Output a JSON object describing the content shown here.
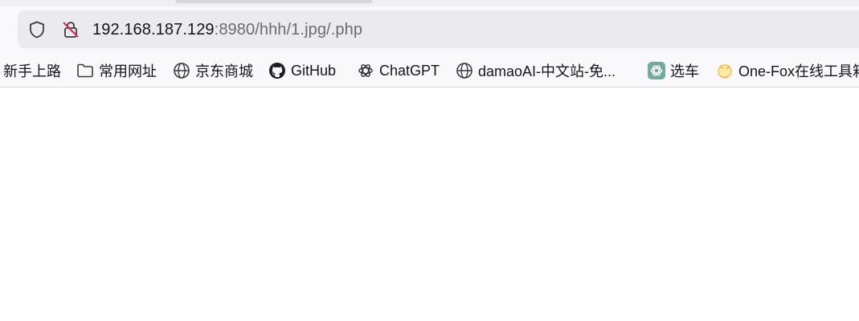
{
  "browser": {
    "url": {
      "host": "192.168.187.129",
      "rest": ":8980/hhh/1.jpg/.php"
    },
    "icons": {
      "tracking_protection": "shield-icon",
      "connection": "insecure-lock-icon"
    }
  },
  "bookmarks": [
    {
      "label": "新手上路",
      "icon": "none"
    },
    {
      "label": "常用网址",
      "icon": "folder-icon"
    },
    {
      "label": "京东商城",
      "icon": "globe-icon"
    },
    {
      "label": "GitHub",
      "icon": "github-icon"
    },
    {
      "label": "ChatGPT",
      "icon": "openai-icon"
    },
    {
      "label": "damaoAI-中文站-免...",
      "icon": "globe-icon"
    },
    {
      "label": "选车",
      "icon": "chatgpt-green-icon"
    },
    {
      "label": "One-Fox在线工具箱",
      "icon": "fox-icon"
    }
  ],
  "colors": {
    "toolbar_bg": "#f9f9fb",
    "urlbar_bg": "#ebebef",
    "insecure_red": "#e22850",
    "chatgpt_green": "#74aa9c"
  }
}
